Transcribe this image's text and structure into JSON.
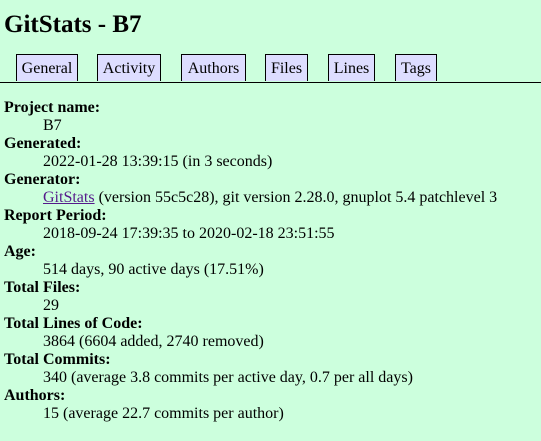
{
  "title": "GitStats - B7",
  "nav": {
    "tabs": [
      {
        "label": "General"
      },
      {
        "label": "Activity"
      },
      {
        "label": "Authors"
      },
      {
        "label": "Files"
      },
      {
        "label": "Lines"
      },
      {
        "label": "Tags"
      }
    ]
  },
  "colors": {
    "background": "#ccffdd",
    "tab_background": "#ddddff",
    "visited_link": "#551a8b"
  },
  "details": {
    "project_name": {
      "label": "Project name:",
      "value": "B7"
    },
    "generated": {
      "label": "Generated:",
      "value": "2022-01-28 13:39:15 (in 3 seconds)"
    },
    "generator": {
      "label": "Generator:",
      "link_text": "GitStats",
      "value_rest": " (version 55c5c28), git version 2.28.0, gnuplot 5.4 patchlevel 3"
    },
    "report_period": {
      "label": "Report Period:",
      "value": "2018-09-24 17:39:35 to 2020-02-18 23:51:55"
    },
    "age": {
      "label": "Age:",
      "value": "514 days, 90 active days (17.51%)"
    },
    "total_files": {
      "label": "Total Files:",
      "value": "29"
    },
    "total_lines": {
      "label": "Total Lines of Code:",
      "value": "3864 (6604 added, 2740 removed)"
    },
    "total_commits": {
      "label": "Total Commits:",
      "value": "340 (average 3.8 commits per active day, 0.7 per all days)"
    },
    "authors": {
      "label": "Authors:",
      "value": "15 (average 22.7 commits per author)"
    }
  }
}
